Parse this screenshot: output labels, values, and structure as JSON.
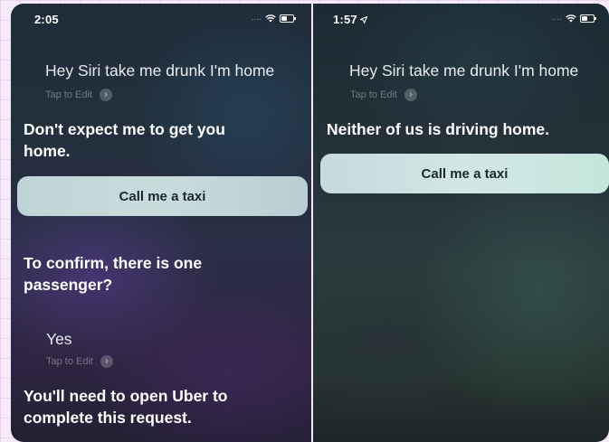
{
  "left_screen": {
    "time": "2:05",
    "query": "Hey Siri take me drunk I'm home",
    "tap_to_edit": "Tap to Edit",
    "response": "Don't expect me to get you home.",
    "button_label": "Call me a taxi",
    "confirm_question": "To confirm, there is one passenger?",
    "answer": "Yes",
    "answer_tap_to_edit": "Tap to Edit",
    "final_message": "You'll need to open Uber to complete this request."
  },
  "right_screen": {
    "time": "1:57",
    "query": "Hey Siri take me drunk I'm home",
    "tap_to_edit": "Tap to Edit",
    "response": "Neither of us is driving home.",
    "button_label": "Call me a taxi"
  },
  "icons": [
    "signal-dots-icon",
    "wifi-icon",
    "battery-icon",
    "location-arrow-icon",
    "chevron-right-icon"
  ],
  "colors": {
    "button_background": "#c9dcdd",
    "button_text": "#1c2830",
    "secondary_text": "#8a9097"
  }
}
